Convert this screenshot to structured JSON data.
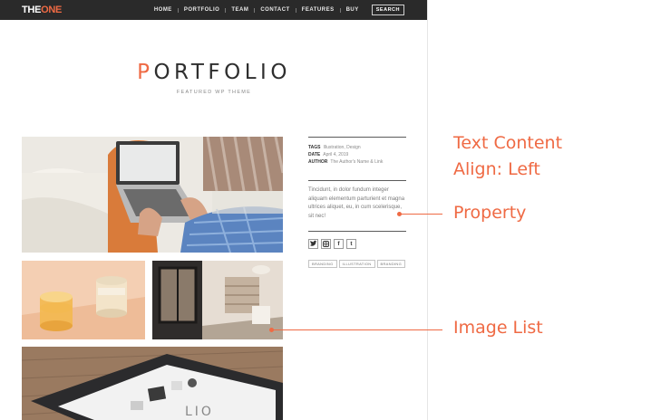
{
  "brand": {
    "logo_part_a": "THE",
    "logo_part_b": "ONE",
    "accent": "#ef6a44",
    "bar_color": "#2a2a2a"
  },
  "nav": {
    "items": [
      "HOME",
      "PORTFOLIO",
      "TEAM",
      "CONTACT",
      "FEATURES",
      "BUY"
    ],
    "search": "SEARCH"
  },
  "page": {
    "title_first": "P",
    "title_rest": "ORTFOLIO",
    "subtitle": "FEATURED WP THEME"
  },
  "meta": {
    "tags_label": "TAGS",
    "tags_value": "Illustration, Design",
    "date_label": "DATE",
    "date_value": "April 4, 2019",
    "author_label": "AUTHOR",
    "author_value": "The Author's Name & Link"
  },
  "description": "Tincidunt, in dolor fundum integer aliquam elementum parturient et magna ultrices aliquet, eu, in cum scelerisque, sit nec!",
  "social": {
    "icons": [
      "twitter-icon",
      "instagram-icon",
      "facebook-icon",
      "tumblr-icon"
    ],
    "glyphs": [
      "🐦",
      "◻",
      "f",
      "t"
    ]
  },
  "tags": [
    "BRANDING",
    "ILLUSTRATION",
    "BRANDING"
  ],
  "annotations": {
    "text_line1": "Text Content",
    "text_line2": "Align: Left",
    "property": "Property",
    "image_list": "Image List"
  }
}
